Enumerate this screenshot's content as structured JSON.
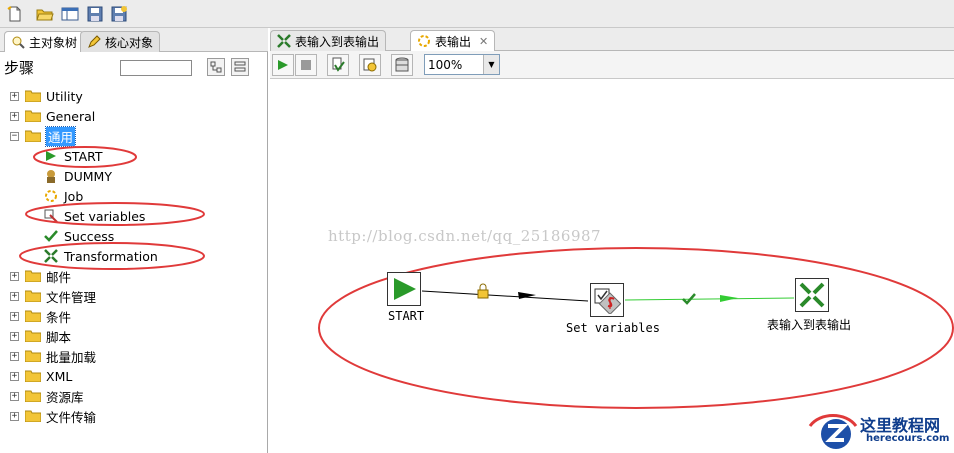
{
  "toolbar": {
    "buttons": [
      "new-file",
      "open-folder",
      "explore-repository",
      "save",
      "save-as"
    ]
  },
  "left_panel": {
    "tabs": [
      {
        "label": "主对象树",
        "active": true
      },
      {
        "label": "核心对象",
        "active": false
      }
    ],
    "steps_label": "步骤",
    "tree": [
      {
        "label": "Utility",
        "expander": "+"
      },
      {
        "label": "General",
        "expander": "+"
      },
      {
        "label": "通用",
        "expander": "−",
        "selected": true
      },
      {
        "label": "START",
        "leaf": true,
        "icon": "start-icon"
      },
      {
        "label": "DUMMY",
        "leaf": true,
        "icon": "dummy-icon"
      },
      {
        "label": "Job",
        "leaf": true,
        "icon": "job-icon"
      },
      {
        "label": "Set variables",
        "leaf": true,
        "icon": "set-variables-icon"
      },
      {
        "label": "Success",
        "leaf": true,
        "icon": "success-icon"
      },
      {
        "label": "Transformation",
        "leaf": true,
        "icon": "transformation-icon"
      },
      {
        "label": "邮件",
        "expander": "+"
      },
      {
        "label": "文件管理",
        "expander": "+"
      },
      {
        "label": "条件",
        "expander": "+"
      },
      {
        "label": "脚本",
        "expander": "+"
      },
      {
        "label": "批量加载",
        "expander": "+"
      },
      {
        "label": "XML",
        "expander": "+"
      },
      {
        "label": "资源库",
        "expander": "+"
      },
      {
        "label": "文件传输",
        "expander": "+"
      }
    ]
  },
  "editor": {
    "tabs": [
      {
        "label": "表输入到表输出",
        "active": false
      },
      {
        "label": "表输出",
        "active": true,
        "close": "✕"
      }
    ],
    "zoom": "100%",
    "watermark": "http://blog.csdn.net/qq_25186987",
    "nodes": [
      {
        "label": "START"
      },
      {
        "label": "Set variables"
      },
      {
        "label": "表输入到表输出"
      }
    ]
  },
  "logo": {
    "name": "这里教程网",
    "url": "herecours.com"
  },
  "colors": {
    "annotation_red": "#e03a3a",
    "selection_blue": "#3399ff",
    "hop_green": "#33cc33",
    "folder_yellow": "#f2c537"
  }
}
